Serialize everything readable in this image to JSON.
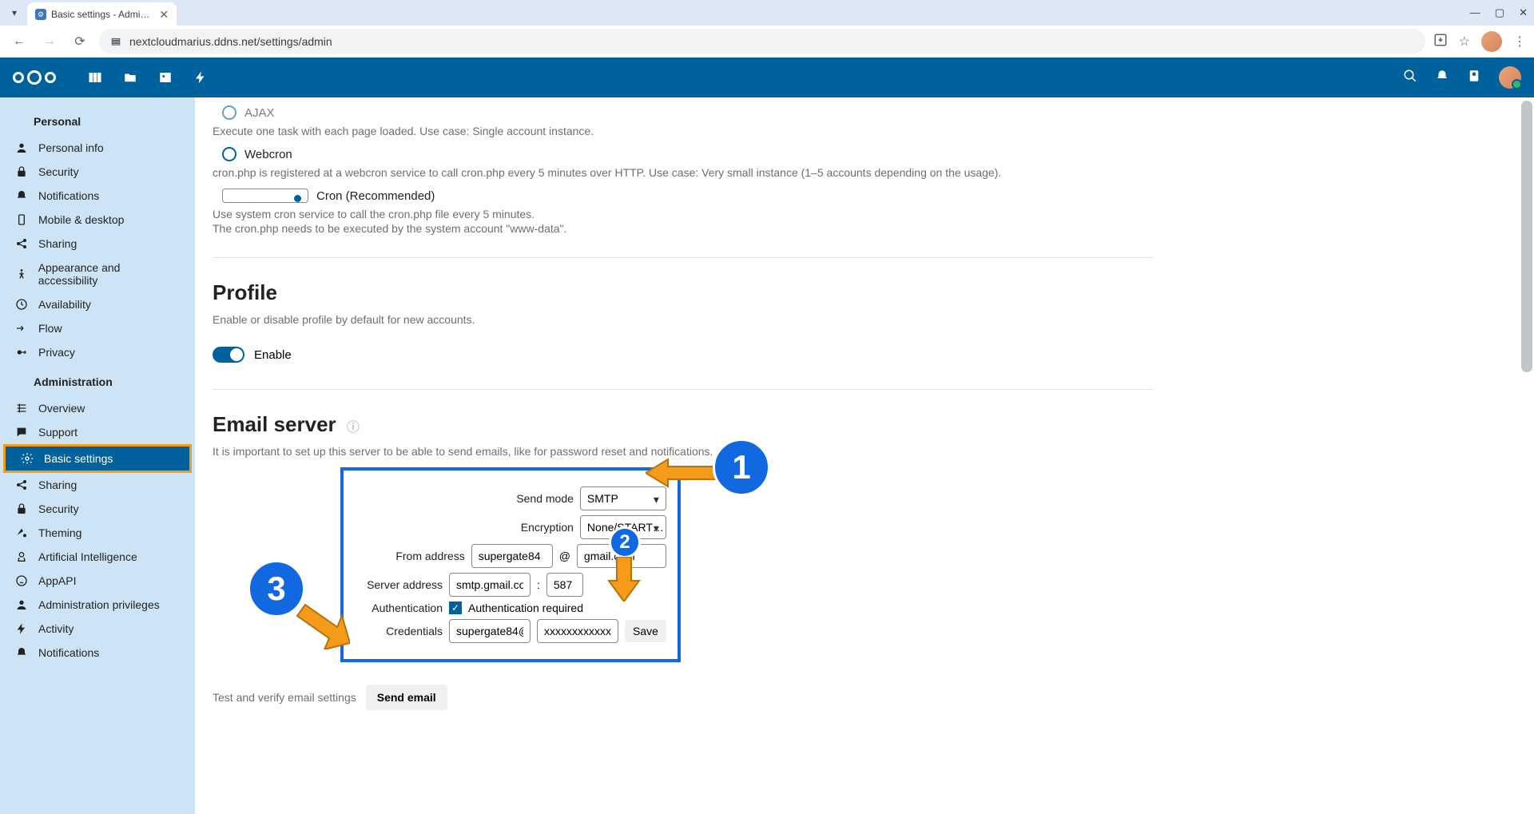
{
  "browser": {
    "tab_title": "Basic settings - Admi…",
    "url": "nextcloudmarius.ddns.net/settings/admin"
  },
  "sidebar": {
    "personal_header": "Personal",
    "personal": [
      {
        "icon": "person",
        "label": "Personal info"
      },
      {
        "icon": "lock",
        "label": "Security"
      },
      {
        "icon": "bell",
        "label": "Notifications"
      },
      {
        "icon": "mobile",
        "label": "Mobile & desktop"
      },
      {
        "icon": "share",
        "label": "Sharing"
      },
      {
        "icon": "access",
        "label": "Appearance and accessibility"
      },
      {
        "icon": "clock",
        "label": "Availability"
      },
      {
        "icon": "flow",
        "label": "Flow"
      },
      {
        "icon": "key",
        "label": "Privacy"
      }
    ],
    "admin_header": "Administration",
    "admin": [
      {
        "icon": "grid",
        "label": "Overview"
      },
      {
        "icon": "chat",
        "label": "Support"
      },
      {
        "icon": "gear",
        "label": "Basic settings",
        "active": true
      },
      {
        "icon": "share",
        "label": "Sharing"
      },
      {
        "icon": "lock",
        "label": "Security"
      },
      {
        "icon": "theme",
        "label": "Theming"
      },
      {
        "icon": "ai",
        "label": "Artificial Intelligence"
      },
      {
        "icon": "app",
        "label": "AppAPI"
      },
      {
        "icon": "admin",
        "label": "Administration privileges"
      },
      {
        "icon": "activity",
        "label": "Activity"
      },
      {
        "icon": "bell",
        "label": "Notifications"
      }
    ]
  },
  "cron": {
    "ajax_label": "AJAX",
    "ajax_desc": "Execute one task with each page loaded. Use case: Single account instance.",
    "webcron_label": "Webcron",
    "webcron_desc": "cron.php is registered at a webcron service to call cron.php every 5 minutes over HTTP. Use case: Very small instance (1–5 accounts depending on the usage).",
    "cron_label": "Cron (Recommended)",
    "cron_desc1": "Use system cron service to call the cron.php file every 5 minutes.",
    "cron_desc2": "The cron.php needs to be executed by the system account \"www-data\"."
  },
  "profile": {
    "heading": "Profile",
    "desc": "Enable or disable profile by default for new accounts.",
    "toggle_label": "Enable"
  },
  "email": {
    "heading": "Email server",
    "desc": "It is important to set up this server to be able to send emails, like for password reset and notifications.",
    "send_mode_label": "Send mode",
    "send_mode_value": "SMTP",
    "encryption_label": "Encryption",
    "encryption_value": "None/START…",
    "from_label": "From address",
    "from_user": "supergate84",
    "from_domain": "gmail.com",
    "server_label": "Server address",
    "server_host": "smtp.gmail.com",
    "server_port": "587",
    "auth_label": "Authentication",
    "auth_check_label": "Authentication required",
    "creds_label": "Credentials",
    "creds_user": "supergate84@…",
    "creds_pass": "xxxxxxxxxxxxxxxx…",
    "save_label": "Save",
    "test_label": "Test and verify email settings",
    "send_label": "Send email"
  },
  "anno": {
    "n1": "1",
    "n2": "2",
    "n3": "3"
  }
}
